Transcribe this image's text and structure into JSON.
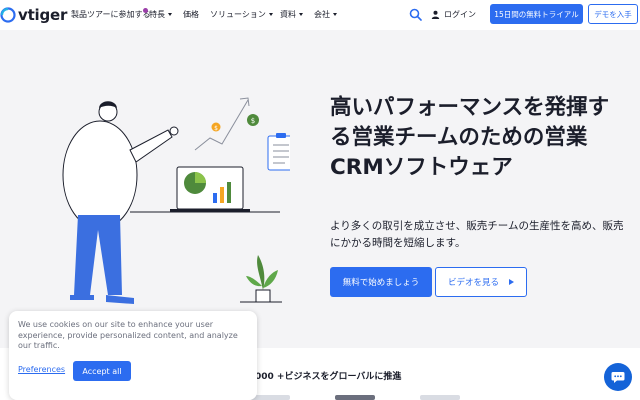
{
  "brand": {
    "name": "vtiger",
    "accent": "#2c6cf0"
  },
  "nav": {
    "items": [
      {
        "label": "製品ツアーに参加する",
        "has_caret": false
      },
      {
        "label": "特長",
        "has_caret": true
      },
      {
        "label": "価格",
        "has_caret": false
      },
      {
        "label": "ソリューション",
        "has_caret": true
      },
      {
        "label": "資料",
        "has_caret": true
      },
      {
        "label": "会社",
        "has_caret": true
      }
    ],
    "login_label": "ログイン",
    "trial_label": "15日間の無料トライアル",
    "demo_label": "デモを入手"
  },
  "hero": {
    "headline": "高いパフォーマンスを発揮する営業チームのための営業CRMソフトウェア",
    "subtext": "より多くの取引を成立させ、販売チームの生産性を高め、販売にかかる時間を短縮します。",
    "primary_cta": "無料で始めましょう",
    "secondary_cta": "ビデオを見る"
  },
  "trusted": {
    "text": "000 +ビジネスをグローバルに推進"
  },
  "cookie": {
    "message": "We use cookies on our site to enhance your user experience, provide personalized content, and analyze our traffic.",
    "preferences_label": "Preferences",
    "accept_label": "Accept all"
  },
  "icons": [
    "vtiger-logo-icon",
    "search-icon",
    "user-icon",
    "play-icon",
    "chat-icon"
  ]
}
